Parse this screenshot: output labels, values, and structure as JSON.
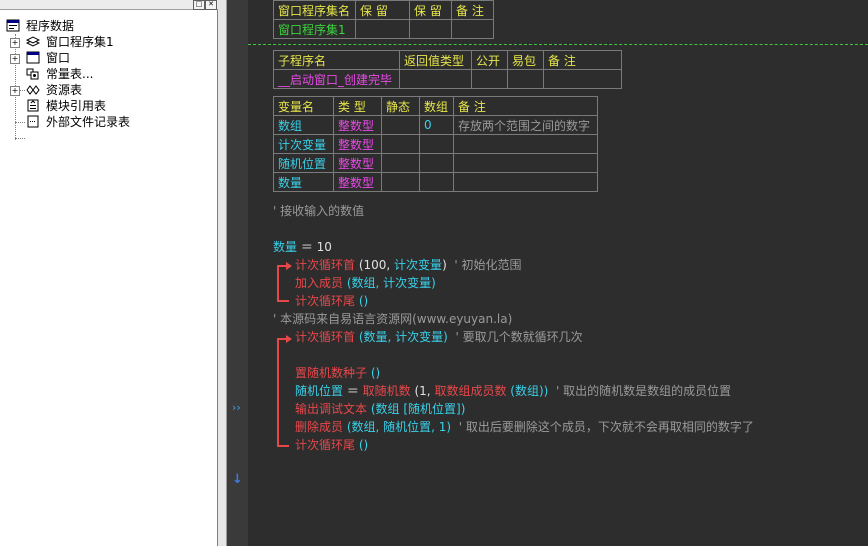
{
  "tree": {
    "items": [
      {
        "label": "程序数据",
        "icon": "program-data-icon"
      },
      {
        "label": "窗口程序集1",
        "icon": "assembly-icon"
      },
      {
        "label": "窗口",
        "icon": "window-icon"
      },
      {
        "label": "常量表...",
        "icon": "constants-icon"
      },
      {
        "label": "资源表",
        "icon": "resources-icon"
      },
      {
        "label": "模块引用表",
        "icon": "module-ref-icon"
      },
      {
        "label": "外部文件记录表",
        "icon": "external-file-icon"
      }
    ],
    "window_buttons": {
      "restore": "□",
      "close": "✕"
    }
  },
  "assembly_table": {
    "headers": [
      "窗口程序集名",
      "保 留",
      "保 留",
      "备 注"
    ],
    "rows": [
      [
        "窗口程序集1",
        "",
        "",
        ""
      ]
    ]
  },
  "sub_table": {
    "headers": [
      "子程序名",
      "返回值类型",
      "公开",
      "易包",
      "备 注"
    ],
    "rows": [
      [
        "__启动窗口_创建完毕",
        "",
        "",
        "",
        ""
      ]
    ]
  },
  "var_table": {
    "headers": [
      "变量名",
      "类 型",
      "静态",
      "数组",
      "备 注"
    ],
    "rows": [
      [
        "数组",
        "整数型",
        "",
        "0",
        "存放两个范围之间的数字"
      ],
      [
        "计次变量",
        "整数型",
        "",
        "",
        ""
      ],
      [
        "随机位置",
        "整数型",
        "",
        "",
        ""
      ],
      [
        "数量",
        "整数型",
        "",
        "",
        ""
      ]
    ]
  },
  "code": {
    "c1": "' 接收输入的数值",
    "l1_a": "数量",
    "l1_b": " ＝ ",
    "l1_c": "10",
    "l2_a": "计次循环首",
    "l2_b": " (100, ",
    "l2_c": "计次变量",
    "l2_d": ")",
    "l2_cmt": "' 初始化范围",
    "l3_a": "加入成员",
    "l3_b": " (数组, 计次变量)",
    "l4_a": "计次循环尾",
    "l4_b": " ()",
    "c2": "' 本源码来自易语言资源网(www.eyuyan.la)",
    "l5_a": "计次循环首",
    "l5_b": " (数量, 计次变量)",
    "l5_cmt": "' 要取几个数就循环几次",
    "l6_a": "置随机数种子",
    "l6_b": " ()",
    "l7_a": "随机位置",
    "l7_b": " ＝ ",
    "l7_c": "取随机数",
    "l7_d": " (1, ",
    "l7_e": "取数组成员数",
    "l7_f": " (数组))",
    "l7_cmt": "' 取出的随机数是数组的成员位置",
    "l8_a": "输出调试文本",
    "l8_b": " (数组 [随机位置])",
    "l9_a": "删除成员",
    "l9_b": " (数组, 随机位置, 1)",
    "l9_cmt": "' 取出后要删除这个成员，下次就不会再取相同的数字了",
    "l10_a": "计次循环尾",
    "l10_b": " ()"
  },
  "gutter": {
    "current_line_marker": "››",
    "down_arrow": "↓"
  }
}
